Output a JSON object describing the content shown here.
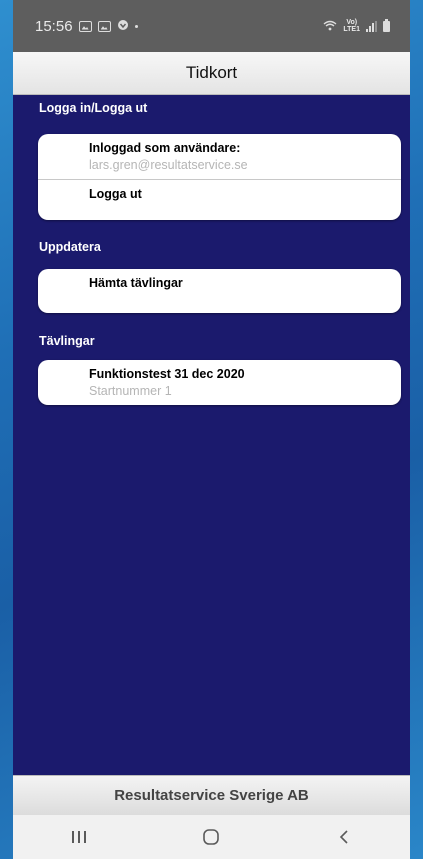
{
  "status_bar": {
    "time": "15:56",
    "network": "LTE1"
  },
  "app": {
    "title": "Tidkort"
  },
  "sections": {
    "login": {
      "header": "Logga in/Logga ut",
      "logged_in_title": "Inloggad som användare:",
      "logged_in_user": "lars.gren@resultatservice.se",
      "logout_label": "Logga ut"
    },
    "update": {
      "header": "Uppdatera",
      "fetch_label": "Hämta tävlingar"
    },
    "competitions": {
      "header": "Tävlingar",
      "items": [
        {
          "title": "Funktionstest 31 dec 2020",
          "subtitle": "Startnummer 1"
        }
      ]
    }
  },
  "footer": {
    "label": "Resultatservice Sverige AB"
  },
  "nav": {
    "recents": "recents-icon",
    "home": "home-icon",
    "back": "back-icon"
  }
}
